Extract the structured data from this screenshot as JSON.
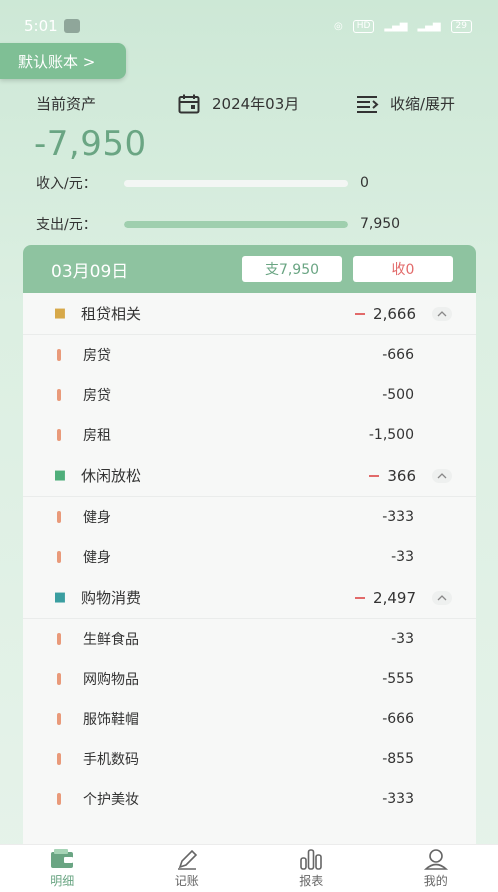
{
  "status": {
    "time": "5:01",
    "battery": "29"
  },
  "ledger_button": "默认账本 >",
  "header": {
    "asset_label": "当前资产",
    "month": "2024年03月",
    "toggle_label": "收缩/展开",
    "asset_value": "-7,950"
  },
  "metrics": {
    "income": {
      "label": "收入/元：",
      "value": "0",
      "fill": 0
    },
    "expense": {
      "label": "支出/元：",
      "value": "7,950",
      "fill": 1
    }
  },
  "day": {
    "date": "03月09日",
    "expense_chip": "支7,950",
    "income_chip": "收0"
  },
  "categories": [
    {
      "name": "租贷相关",
      "icon": "house-icon",
      "total": "2,666",
      "items": [
        {
          "name": "房贷",
          "amount": "-666"
        },
        {
          "name": "房贷",
          "amount": "-500"
        },
        {
          "name": "房租",
          "amount": "-1,500"
        }
      ]
    },
    {
      "name": "休闲放松",
      "icon": "palm-tree-icon",
      "total": "366",
      "items": [
        {
          "name": "健身",
          "amount": "-333"
        },
        {
          "name": "健身",
          "amount": "-33"
        }
      ]
    },
    {
      "name": "购物消费",
      "icon": "cart-icon",
      "total": "2,497",
      "items": [
        {
          "name": "生鲜食品",
          "amount": "-33"
        },
        {
          "name": "网购物品",
          "amount": "-555"
        },
        {
          "name": "服饰鞋帽",
          "amount": "-666"
        },
        {
          "name": "手机数码",
          "amount": "-855"
        },
        {
          "name": "个护美妆",
          "amount": "-333"
        }
      ]
    }
  ],
  "tabs": [
    {
      "label": "明细",
      "icon": "wallet-icon",
      "active": true
    },
    {
      "label": "记账",
      "icon": "pen-icon",
      "active": false
    },
    {
      "label": "报表",
      "icon": "bar-chart-icon",
      "active": false
    },
    {
      "label": "我的",
      "icon": "user-icon",
      "active": false
    }
  ],
  "colors": {
    "accent": "#6aa583",
    "header": "#8ec3a0",
    "negative": "#e26a6a",
    "marker": "#e99a7a"
  }
}
